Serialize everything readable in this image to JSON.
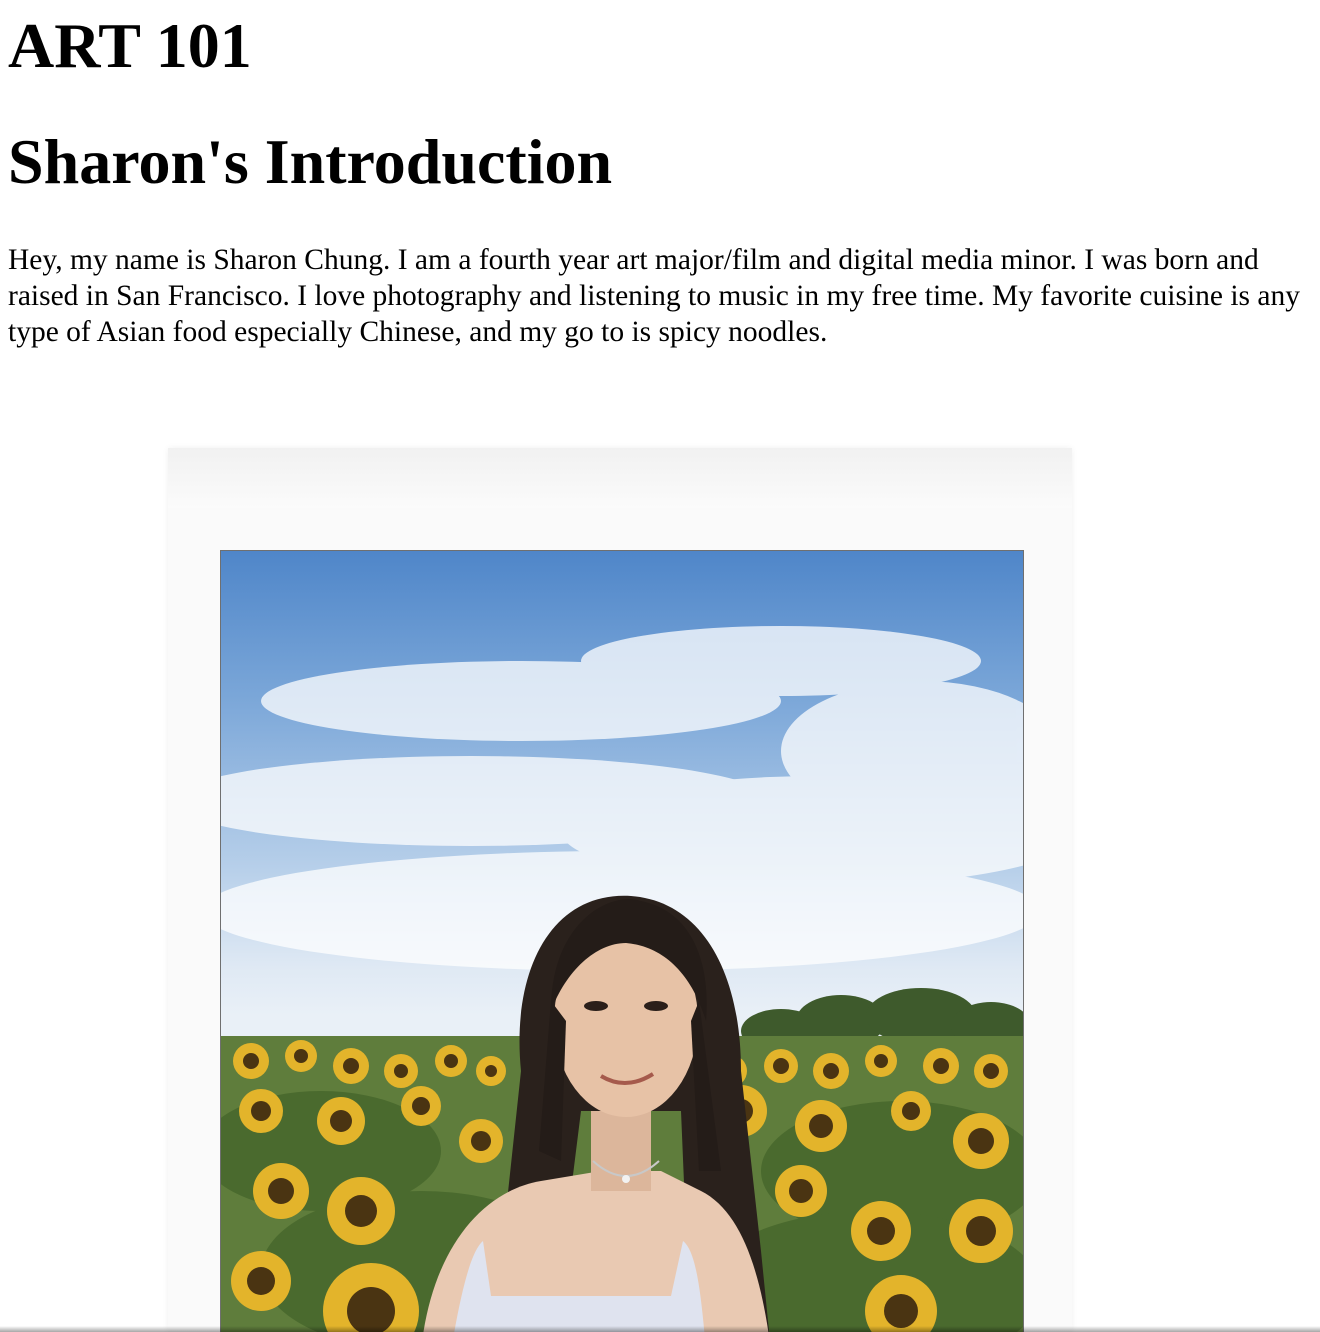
{
  "header": {
    "site_title": "ART 101",
    "page_title": "Sharon's Introduction"
  },
  "main": {
    "intro_text": "Hey, my name is Sharon Chung. I am a fourth year art major/film and digital media minor. I was born and raised in San Francisco. I love photography and listening to music in my free time. My favorite cuisine is any type of Asian food especially Chinese, and my go to is spicy noodles."
  },
  "colors": {
    "text": "#000000",
    "background": "#ffffff",
    "sky": "#5a8fcf",
    "sunflower": "#e0b22a",
    "leaves": "#5d7a3a"
  }
}
